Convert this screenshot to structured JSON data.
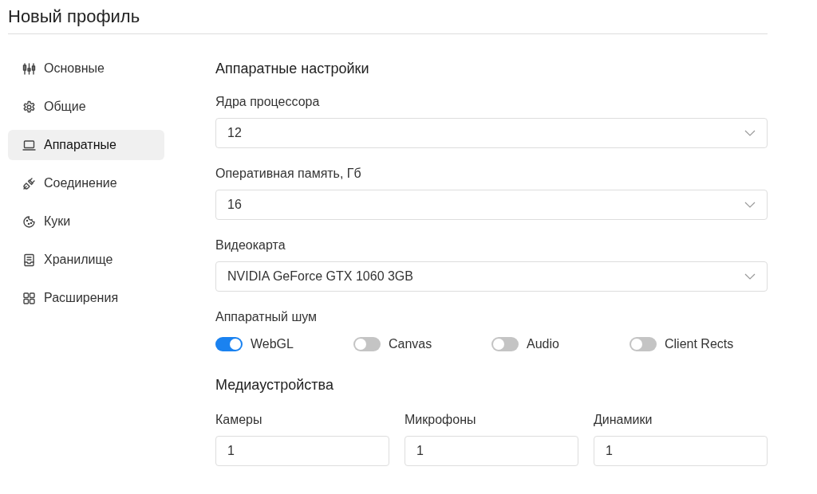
{
  "title": "Новый профиль",
  "sidebar": {
    "items": [
      {
        "label": "Основные",
        "kind": "sliders",
        "selected": false
      },
      {
        "label": "Общие",
        "kind": "gear",
        "selected": false
      },
      {
        "label": "Аппаратные",
        "kind": "laptop",
        "selected": true
      },
      {
        "label": "Соединение",
        "kind": "plug",
        "selected": false
      },
      {
        "label": "Куки",
        "kind": "cookie",
        "selected": false
      },
      {
        "label": "Хранилище",
        "kind": "document",
        "selected": false
      },
      {
        "label": "Расширения",
        "kind": "grid",
        "selected": false
      }
    ]
  },
  "hardware": {
    "heading": "Аппаратные настройки",
    "selects": [
      {
        "label": "Ядра процессора",
        "value": "12"
      },
      {
        "label": "Оперативная память, Гб",
        "value": "16"
      },
      {
        "label": "Видеокарта",
        "value": "NVIDIA GeForce GTX 1060 3GB"
      }
    ],
    "noise": {
      "label": "Аппаратный шум",
      "toggles": [
        {
          "label": "WebGL",
          "on": true
        },
        {
          "label": "Canvas",
          "on": false
        },
        {
          "label": "Audio",
          "on": false
        },
        {
          "label": "Client Rects",
          "on": false
        }
      ]
    }
  },
  "media": {
    "heading": "Медиаустройства",
    "fields": [
      {
        "label": "Камеры",
        "value": "1"
      },
      {
        "label": "Микрофоны",
        "value": "1"
      },
      {
        "label": "Динамики",
        "value": "1"
      }
    ]
  }
}
